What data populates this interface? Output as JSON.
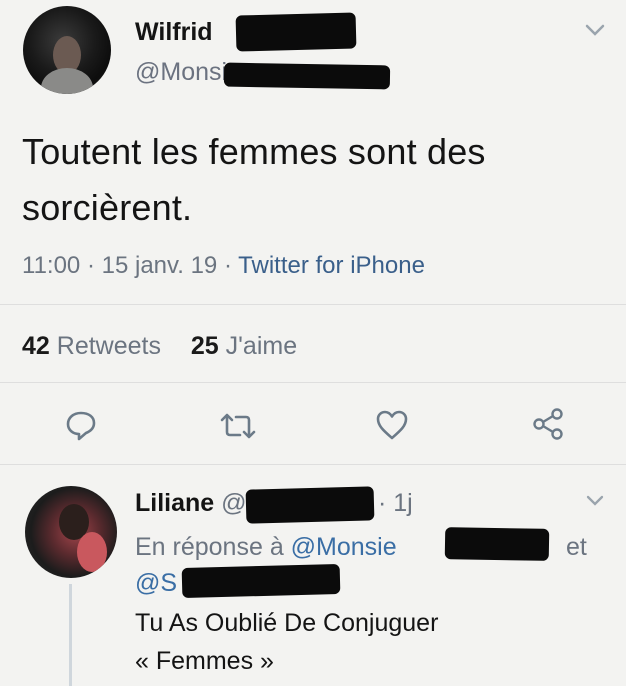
{
  "tweet": {
    "author_name": "Wilfrid",
    "author_handle": "@Monsie",
    "text_line1": "Toutent les femmes sont des",
    "text_line2": "sorcièrent.",
    "time": "11:00",
    "sep1": "·",
    "date": "15 janv. 19",
    "sep2": "·",
    "source": "Twitter for iPhone",
    "retweets_count": "42",
    "retweets_label": "Retweets",
    "likes_count": "25",
    "likes_label": "J'aime"
  },
  "reply": {
    "author_name": "Liliane",
    "handle_prefix": "@",
    "age": "· 1j",
    "in_reply_prefix": "En réponse à",
    "in_reply_handle": "@Monsie",
    "in_reply_and": "et",
    "second_handle": "@S",
    "text_line1": "Tu As Oublié De Conjuguer",
    "text_line2": "« Femmes »"
  },
  "icons": {
    "reply": "reply-icon",
    "retweet": "retweet-icon",
    "like": "heart-icon",
    "share": "share-icon",
    "more": "chevron-down-icon"
  }
}
